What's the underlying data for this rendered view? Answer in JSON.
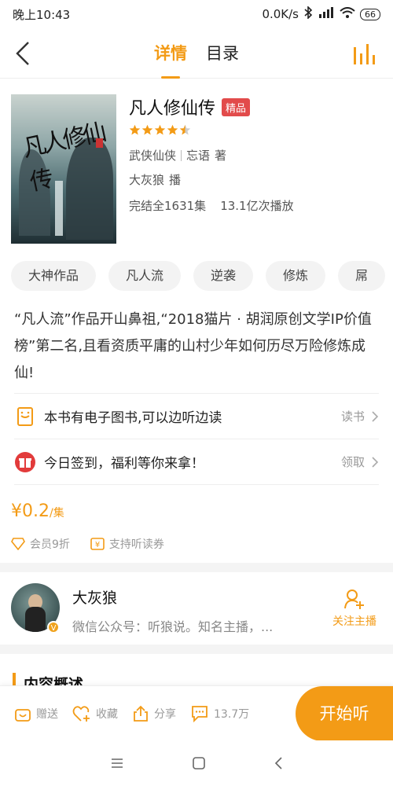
{
  "status": {
    "time": "晚上10:43",
    "speed": "0.0K/s",
    "battery": "66"
  },
  "nav": {
    "tabs": [
      {
        "label": "详情"
      },
      {
        "label": "目录"
      }
    ]
  },
  "book": {
    "title": "凡人修仙传",
    "badge": "精品",
    "rating_stars": 4.5,
    "genre": "武侠仙侠",
    "author": "忘语",
    "author_suffix": "著",
    "narrator": "大灰狼",
    "narrator_suffix": "播",
    "status": "完结全1631集",
    "plays": "13.1亿次播放",
    "cover_text": "凡人修仙传"
  },
  "tags": [
    "大神作品",
    "凡人流",
    "逆袭",
    "修炼",
    "屌"
  ],
  "description": "“凡人流”作品开山鼻祖,“2018猫片 · 胡润原创文学IP价值榜”第二名,且看资质平庸的山村少年如何历尽万险修炼成仙!",
  "rows": [
    {
      "text": "本书有电子图书,可以边听边读",
      "action": "读书"
    },
    {
      "text": "今日签到，福利等你来拿！",
      "action": "领取"
    }
  ],
  "price": {
    "amount": "¥0.2",
    "unit": "/集"
  },
  "perks": [
    "会员9折",
    "支持听读券"
  ],
  "anchor": {
    "name": "大灰狼",
    "desc": "微信公众号：听狼说。知名主播，...",
    "follow": "关注主播"
  },
  "section": {
    "title": "内容概述"
  },
  "bottom": {
    "gift": "赠送",
    "collect": "收藏",
    "share": "分享",
    "comments": "13.7万",
    "start": "开始听"
  },
  "colors": {
    "accent": "#f39b16",
    "badge": "#e24b4b"
  }
}
